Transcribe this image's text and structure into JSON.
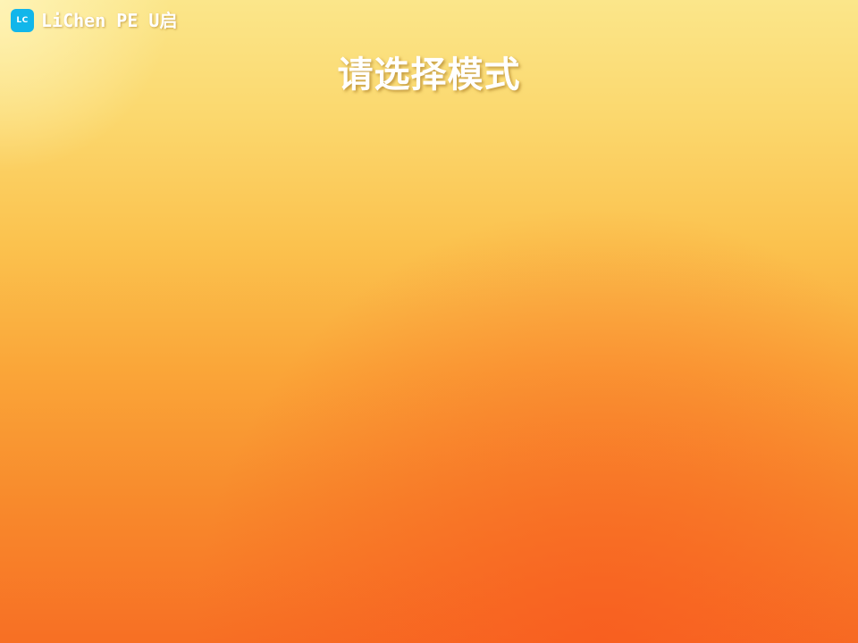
{
  "app": {
    "logo_text": "LC",
    "name": "LiChen PE U启"
  },
  "main": {
    "title": "请选择模式"
  },
  "colors": {
    "logo_background": "#12b6ea",
    "background_top": "#fbe68a",
    "background_bottom": "#f76f24",
    "text": "#ffffff"
  }
}
